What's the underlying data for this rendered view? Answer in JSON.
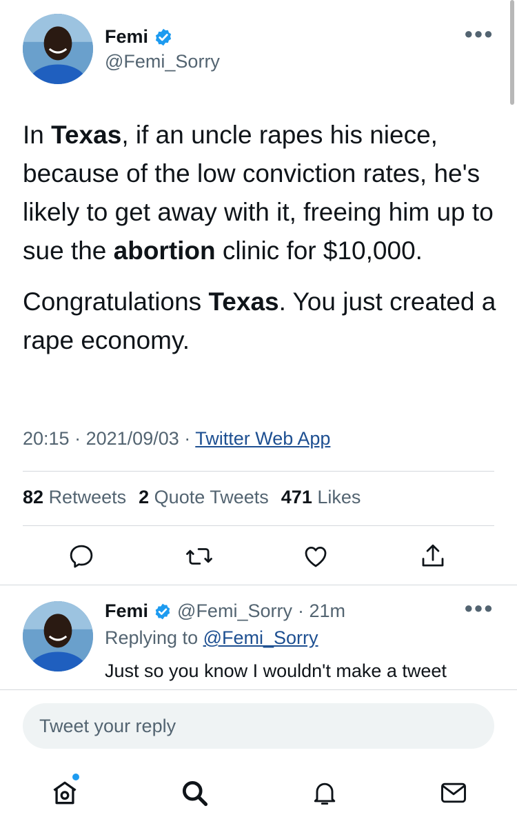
{
  "colors": {
    "text": "#0f1419",
    "secondary": "#536471",
    "link": "#1d4f91",
    "verified": "#1d9bf0"
  },
  "tweet": {
    "author_name": "Femi",
    "author_handle": "@Femi_Sorry",
    "more_icon": "more-horizontal-icon",
    "paragraph1": [
      {
        "text": "In ",
        "bold": false
      },
      {
        "text": "Texas",
        "bold": true
      },
      {
        "text": ", if an uncle rapes his niece, because of the low conviction rates, he's likely to get away with it, freeing him up to sue the ",
        "bold": false
      },
      {
        "text": "abortion",
        "bold": true
      },
      {
        "text": " clinic for $10,000.",
        "bold": false
      }
    ],
    "paragraph2": [
      {
        "text": "Congratulations ",
        "bold": false
      },
      {
        "text": "Texas",
        "bold": true
      },
      {
        "text": ". You just created a rape economy.",
        "bold": false
      }
    ],
    "time": "20:15",
    "date": "2021/09/03",
    "source": "Twitter Web App",
    "separator": "·",
    "stats": {
      "retweets_count": "82",
      "retweets_label": "Retweets",
      "quotes_count": "2",
      "quotes_label": "Quote Tweets",
      "likes_count": "471",
      "likes_label": "Likes"
    },
    "actions": [
      "reply-icon",
      "retweet-icon",
      "like-icon",
      "share-icon"
    ]
  },
  "reply": {
    "author_name": "Femi",
    "author_handle": "@Femi_Sorry",
    "age": "· 21m",
    "replying_prefix": "Replying to",
    "replying_handle": "@Femi_Sorry",
    "text": "Just so you know I wouldn't make a tweet"
  },
  "composer": {
    "placeholder": "Tweet your reply"
  },
  "tabbar": [
    "home-icon",
    "search-icon",
    "notifications-icon",
    "messages-icon"
  ]
}
